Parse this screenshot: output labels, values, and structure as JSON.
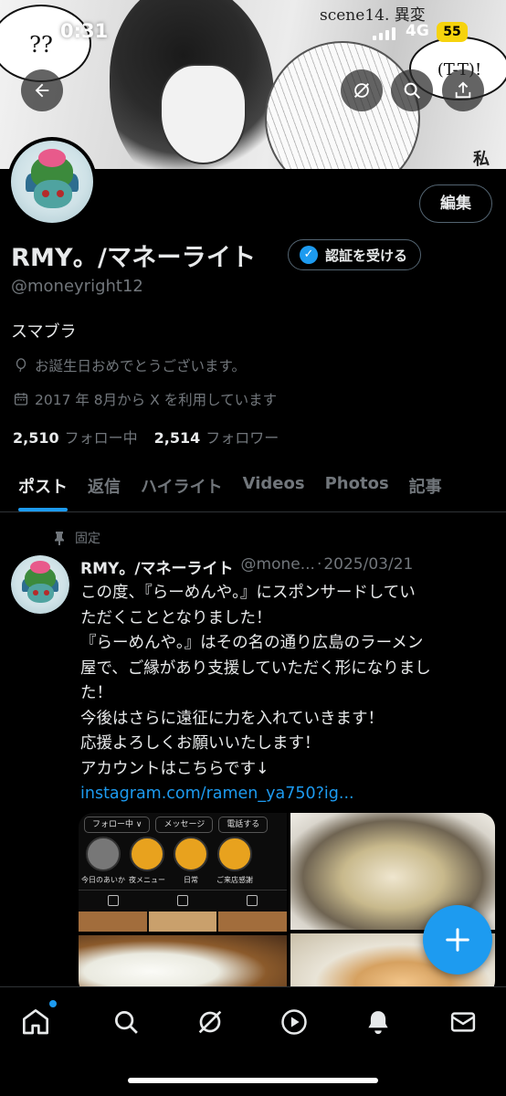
{
  "status_bar": {
    "time": "0:31",
    "network": "4G",
    "battery": "55"
  },
  "banner": {
    "bubble_left": "??",
    "bubble_right": "(T-T)!",
    "scene_text": "scene14. 異変",
    "side_text": "私"
  },
  "profile": {
    "edit_label": "編集",
    "name": "RMY。/マネーライト",
    "verify_label": "認証を受ける",
    "handle": "@moneyright12",
    "bio": "スマブラ",
    "birthday_text": "お誕生日おめでとうございます。",
    "joined_text": "2017 年 8月から X を利用しています",
    "following_count": "2,510",
    "following_label": "フォロー中",
    "followers_count": "2,514",
    "followers_label": "フォロワー"
  },
  "tabs": [
    {
      "label": "ポスト",
      "active": true
    },
    {
      "label": "返信",
      "active": false
    },
    {
      "label": "ハイライト",
      "active": false
    },
    {
      "label": "Videos",
      "active": false
    },
    {
      "label": "Photos",
      "active": false
    },
    {
      "label": "記事",
      "active": false
    }
  ],
  "post": {
    "pinned_label": "固定",
    "author_name": "RMY。/マネーライト",
    "author_handle_trunc": "@mone...",
    "separator": "·",
    "date": "2025/03/21",
    "lines": [
      "この度、『らーめんや。』にスポンサードしてい",
      "ただくこととなりました！",
      "『らーめんや。』はその名の通り広島のラーメン",
      "屋で、ご縁があり支援していただく形になりまし",
      "た！",
      "今後はさらに遠征に力を入れていきます！",
      "応援よろしくお願いいたします！",
      "アカウントはこちらです↓"
    ],
    "link": "instagram.com/ramen_ya750?ig...",
    "media_ui": {
      "following_btn": "フォロー中 ∨",
      "message_btn": "メッセージ",
      "call_btn": "電話する",
      "highlights": [
        "今日のあいか",
        "夜メニュー",
        "日常",
        "ご来店感謝"
      ]
    }
  },
  "colors": {
    "accent": "#1d9bf0",
    "background": "#000000",
    "muted": "#71767b",
    "text": "#e7e9ea",
    "battery": "#f6d30d"
  },
  "icons": [
    "back-arrow-icon",
    "grok-icon",
    "search-icon",
    "share-icon",
    "verified-badge-icon",
    "balloon-icon",
    "calendar-icon",
    "pin-icon",
    "plus-icon",
    "home-icon",
    "explore-icon",
    "grok-nav-icon",
    "video-icon",
    "bell-icon",
    "mail-icon"
  ]
}
